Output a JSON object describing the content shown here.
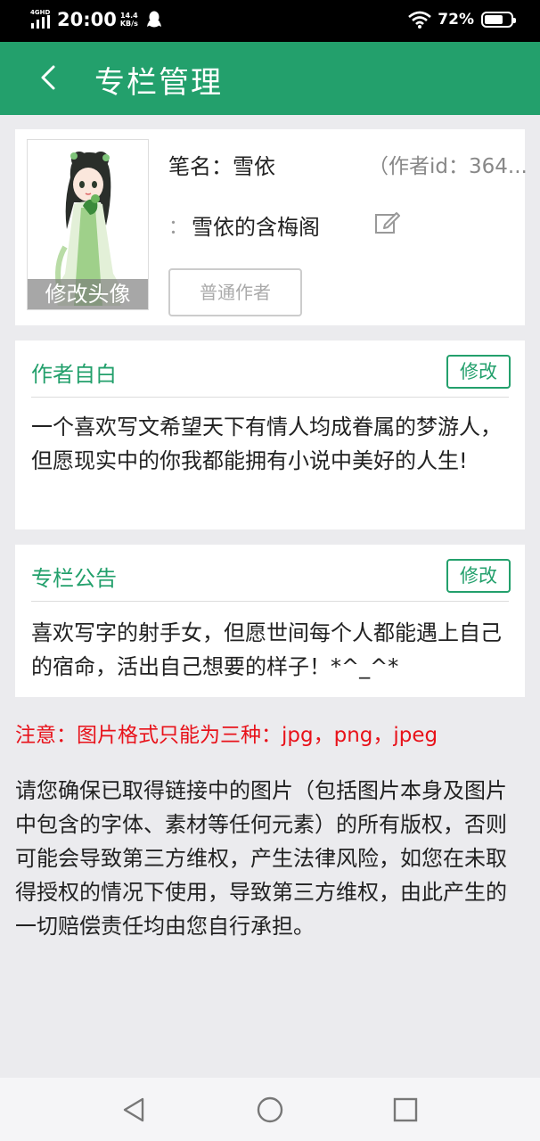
{
  "status_bar": {
    "network": "4GHD",
    "time": "20:00",
    "speed_value": "14.4",
    "speed_unit": "KB/s",
    "battery": "72%",
    "battery_level": 0.72
  },
  "header": {
    "title": "专栏管理"
  },
  "profile": {
    "avatar_button": "修改头像",
    "pen_name": "笔名：雪依",
    "author_id": "（作者id：364...",
    "column_colon": "：",
    "column_name": "雪依的含梅阁",
    "author_level": "普通作者"
  },
  "bio": {
    "heading": "作者自白",
    "edit_label": "修改",
    "text": "一个喜欢写文希望天下有情人均成眷属的梦游人，但愿现实中的你我都能拥有小说中美好的人生!"
  },
  "notice": {
    "heading": "专栏公告",
    "edit_label": "修改",
    "text": "喜欢写字的射手女，但愿世间每个人都能遇上自己的宿命，活出自己想要的样子！*^_^*"
  },
  "warning": "注意：图片格式只能为三种：jpg，png，jpeg",
  "disclaimer": "请您确保已取得链接中的图片（包括图片本身及图片中包含的字体、素材等任何元素）的所有版权，否则可能会导致第三方维权，产生法律风险，如您在未取得授权的情况下使用，导致第三方维权，由此产生的一切赔偿责任均由您自行承担。",
  "colors": {
    "accent": "#23a06c",
    "warning": "#e8121a",
    "background": "#ebebee"
  },
  "icons": [
    "signal-icon",
    "qq-icon",
    "wifi-icon",
    "battery-icon",
    "back-arrow-icon",
    "edit-pencil-icon",
    "nav-back-icon",
    "nav-home-icon",
    "nav-recents-icon"
  ]
}
